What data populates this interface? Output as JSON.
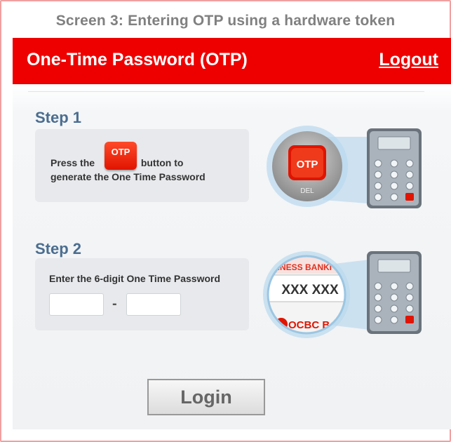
{
  "caption": "Screen 3: Entering OTP using a hardware token",
  "header": {
    "title": "One-Time Password (OTP)",
    "logout_label": "Logout"
  },
  "step1": {
    "title": "Step 1",
    "text_before": "Press the",
    "otp_button_label": "OTP",
    "text_after": "button  to",
    "text_line2": "generate the One Time Password",
    "zoom_button_label": "OTP",
    "zoom_sub_label": "DEL"
  },
  "step2": {
    "title": "Step 2",
    "instruction": "Enter the 6-digit One Time Password",
    "separator": "-",
    "zoom_screen_header": "USINESS BANKI",
    "zoom_screen_code": "XXX XXX",
    "zoom_brand": "OCBC B"
  },
  "login_label": "Login",
  "colors": {
    "brand_red": "#ee0000",
    "step_title": "#4b6d8f"
  }
}
